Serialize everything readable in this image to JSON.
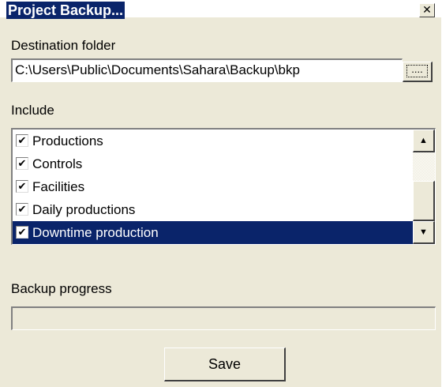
{
  "window": {
    "title": "Project Backup...",
    "close_glyph": "✕"
  },
  "destination": {
    "label": "Destination folder",
    "value": "C:\\Users\\Public\\Documents\\Sahara\\Backup\\bkp",
    "browse_glyph": "...."
  },
  "include": {
    "label": "Include",
    "items": [
      {
        "label": "Productions",
        "checked": true,
        "selected": false
      },
      {
        "label": "Controls",
        "checked": true,
        "selected": false
      },
      {
        "label": "Facilities",
        "checked": true,
        "selected": false
      },
      {
        "label": "Daily productions",
        "checked": true,
        "selected": false
      },
      {
        "label": "Downtime production",
        "checked": true,
        "selected": true
      }
    ],
    "check_glyph": "✔",
    "scroll_up_glyph": "▲",
    "scroll_down_glyph": "▼"
  },
  "progress": {
    "label": "Backup progress",
    "value": 0
  },
  "actions": {
    "save_label": "Save"
  },
  "colors": {
    "face": "#ece9d8",
    "selection": "#0a246a",
    "title_bg": "#0a246a"
  }
}
